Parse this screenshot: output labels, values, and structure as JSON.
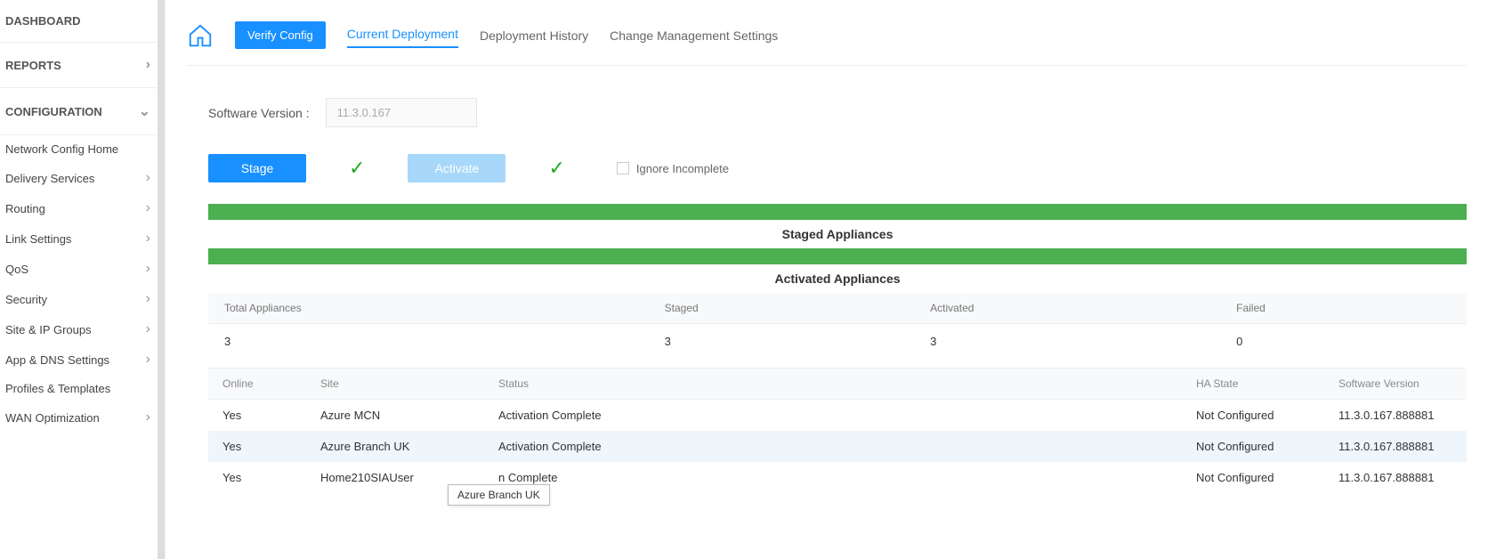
{
  "sidebar": {
    "sections": [
      {
        "label": "DASHBOARD",
        "type": "section",
        "arrow": ""
      },
      {
        "label": "REPORTS",
        "type": "section",
        "arrow": "›"
      },
      {
        "label": "CONFIGURATION",
        "type": "section",
        "arrow": "⌄"
      }
    ],
    "configItems": [
      {
        "label": "Network Config Home",
        "arrow": ""
      },
      {
        "label": "Delivery Services",
        "arrow": "›"
      },
      {
        "label": "Routing",
        "arrow": "›"
      },
      {
        "label": "Link Settings",
        "arrow": "›"
      },
      {
        "label": "QoS",
        "arrow": "›"
      },
      {
        "label": "Security",
        "arrow": "›"
      },
      {
        "label": "Site & IP Groups",
        "arrow": "›"
      },
      {
        "label": "App & DNS Settings",
        "arrow": "›"
      },
      {
        "label": "Profiles & Templates",
        "arrow": ""
      },
      {
        "label": "WAN Optimization",
        "arrow": "›"
      }
    ]
  },
  "tabs": {
    "verify": "Verify Config",
    "current": "Current Deployment",
    "history": "Deployment History",
    "change": "Change Management Settings"
  },
  "software": {
    "label": "Software Version :",
    "value": "11.3.0.167"
  },
  "actions": {
    "stage": "Stage",
    "activate": "Activate",
    "ignore": "Ignore Incomplete"
  },
  "sections": {
    "staged": "Staged Appliances",
    "activated": "Activated Appliances"
  },
  "summary": {
    "headers": [
      "Total Appliances",
      "Staged",
      "Activated",
      "Failed"
    ],
    "values": [
      "3",
      "3",
      "3",
      "0"
    ]
  },
  "tableHeaders": [
    "Online",
    "Site",
    "Status",
    "HA State",
    "Software Version"
  ],
  "rows": [
    {
      "online": "Yes",
      "site": "Azure MCN",
      "status": "Activation Complete",
      "ha": "Not Configured",
      "sw": "11.3.0.167.888881",
      "hl": false
    },
    {
      "online": "Yes",
      "site": "Azure Branch UK",
      "status": "Activation Complete",
      "ha": "Not Configured",
      "sw": "11.3.0.167.888881",
      "hl": true
    },
    {
      "online": "Yes",
      "site": "Home210SIAUser",
      "status": "n Complete",
      "ha": "Not Configured",
      "sw": "11.3.0.167.888881",
      "hl": false
    }
  ],
  "tooltip": "Azure Branch UK"
}
